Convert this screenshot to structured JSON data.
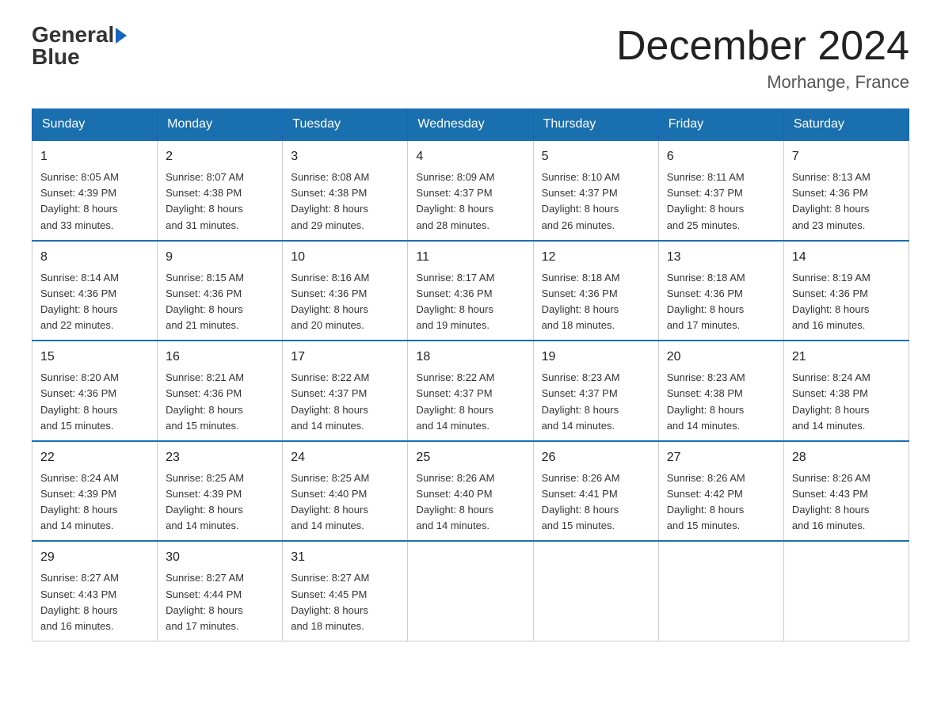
{
  "logo": {
    "text_general": "General",
    "text_blue": "Blue",
    "arrow_color": "#1565c0"
  },
  "title": "December 2024",
  "subtitle": "Morhange, France",
  "days_of_week": [
    "Sunday",
    "Monday",
    "Tuesday",
    "Wednesday",
    "Thursday",
    "Friday",
    "Saturday"
  ],
  "weeks": [
    [
      {
        "day": "1",
        "info": "Sunrise: 8:05 AM\nSunset: 4:39 PM\nDaylight: 8 hours\nand 33 minutes."
      },
      {
        "day": "2",
        "info": "Sunrise: 8:07 AM\nSunset: 4:38 PM\nDaylight: 8 hours\nand 31 minutes."
      },
      {
        "day": "3",
        "info": "Sunrise: 8:08 AM\nSunset: 4:38 PM\nDaylight: 8 hours\nand 29 minutes."
      },
      {
        "day": "4",
        "info": "Sunrise: 8:09 AM\nSunset: 4:37 PM\nDaylight: 8 hours\nand 28 minutes."
      },
      {
        "day": "5",
        "info": "Sunrise: 8:10 AM\nSunset: 4:37 PM\nDaylight: 8 hours\nand 26 minutes."
      },
      {
        "day": "6",
        "info": "Sunrise: 8:11 AM\nSunset: 4:37 PM\nDaylight: 8 hours\nand 25 minutes."
      },
      {
        "day": "7",
        "info": "Sunrise: 8:13 AM\nSunset: 4:36 PM\nDaylight: 8 hours\nand 23 minutes."
      }
    ],
    [
      {
        "day": "8",
        "info": "Sunrise: 8:14 AM\nSunset: 4:36 PM\nDaylight: 8 hours\nand 22 minutes."
      },
      {
        "day": "9",
        "info": "Sunrise: 8:15 AM\nSunset: 4:36 PM\nDaylight: 8 hours\nand 21 minutes."
      },
      {
        "day": "10",
        "info": "Sunrise: 8:16 AM\nSunset: 4:36 PM\nDaylight: 8 hours\nand 20 minutes."
      },
      {
        "day": "11",
        "info": "Sunrise: 8:17 AM\nSunset: 4:36 PM\nDaylight: 8 hours\nand 19 minutes."
      },
      {
        "day": "12",
        "info": "Sunrise: 8:18 AM\nSunset: 4:36 PM\nDaylight: 8 hours\nand 18 minutes."
      },
      {
        "day": "13",
        "info": "Sunrise: 8:18 AM\nSunset: 4:36 PM\nDaylight: 8 hours\nand 17 minutes."
      },
      {
        "day": "14",
        "info": "Sunrise: 8:19 AM\nSunset: 4:36 PM\nDaylight: 8 hours\nand 16 minutes."
      }
    ],
    [
      {
        "day": "15",
        "info": "Sunrise: 8:20 AM\nSunset: 4:36 PM\nDaylight: 8 hours\nand 15 minutes."
      },
      {
        "day": "16",
        "info": "Sunrise: 8:21 AM\nSunset: 4:36 PM\nDaylight: 8 hours\nand 15 minutes."
      },
      {
        "day": "17",
        "info": "Sunrise: 8:22 AM\nSunset: 4:37 PM\nDaylight: 8 hours\nand 14 minutes."
      },
      {
        "day": "18",
        "info": "Sunrise: 8:22 AM\nSunset: 4:37 PM\nDaylight: 8 hours\nand 14 minutes."
      },
      {
        "day": "19",
        "info": "Sunrise: 8:23 AM\nSunset: 4:37 PM\nDaylight: 8 hours\nand 14 minutes."
      },
      {
        "day": "20",
        "info": "Sunrise: 8:23 AM\nSunset: 4:38 PM\nDaylight: 8 hours\nand 14 minutes."
      },
      {
        "day": "21",
        "info": "Sunrise: 8:24 AM\nSunset: 4:38 PM\nDaylight: 8 hours\nand 14 minutes."
      }
    ],
    [
      {
        "day": "22",
        "info": "Sunrise: 8:24 AM\nSunset: 4:39 PM\nDaylight: 8 hours\nand 14 minutes."
      },
      {
        "day": "23",
        "info": "Sunrise: 8:25 AM\nSunset: 4:39 PM\nDaylight: 8 hours\nand 14 minutes."
      },
      {
        "day": "24",
        "info": "Sunrise: 8:25 AM\nSunset: 4:40 PM\nDaylight: 8 hours\nand 14 minutes."
      },
      {
        "day": "25",
        "info": "Sunrise: 8:26 AM\nSunset: 4:40 PM\nDaylight: 8 hours\nand 14 minutes."
      },
      {
        "day": "26",
        "info": "Sunrise: 8:26 AM\nSunset: 4:41 PM\nDaylight: 8 hours\nand 15 minutes."
      },
      {
        "day": "27",
        "info": "Sunrise: 8:26 AM\nSunset: 4:42 PM\nDaylight: 8 hours\nand 15 minutes."
      },
      {
        "day": "28",
        "info": "Sunrise: 8:26 AM\nSunset: 4:43 PM\nDaylight: 8 hours\nand 16 minutes."
      }
    ],
    [
      {
        "day": "29",
        "info": "Sunrise: 8:27 AM\nSunset: 4:43 PM\nDaylight: 8 hours\nand 16 minutes."
      },
      {
        "day": "30",
        "info": "Sunrise: 8:27 AM\nSunset: 4:44 PM\nDaylight: 8 hours\nand 17 minutes."
      },
      {
        "day": "31",
        "info": "Sunrise: 8:27 AM\nSunset: 4:45 PM\nDaylight: 8 hours\nand 18 minutes."
      },
      {
        "day": "",
        "info": ""
      },
      {
        "day": "",
        "info": ""
      },
      {
        "day": "",
        "info": ""
      },
      {
        "day": "",
        "info": ""
      }
    ]
  ]
}
